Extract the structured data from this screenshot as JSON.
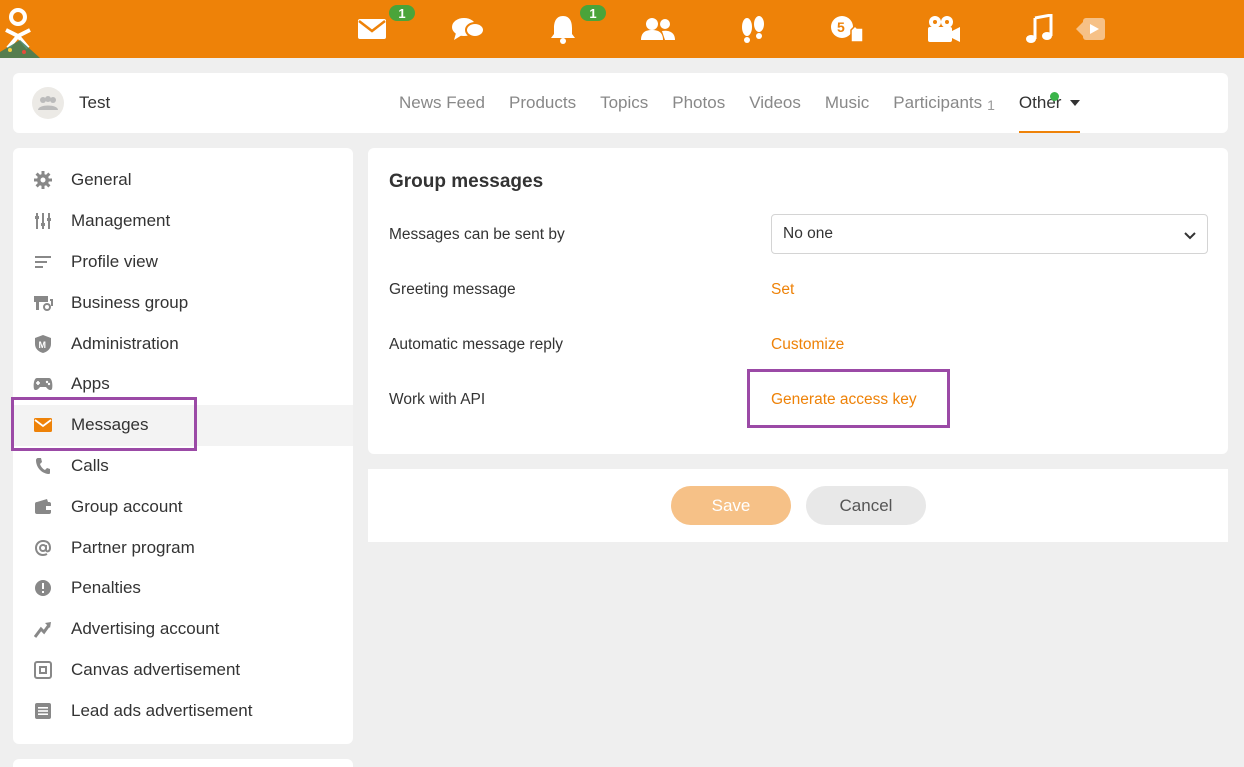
{
  "topbar": {
    "brand_color": "#ee8208",
    "icons": [
      {
        "name": "messages-icon",
        "badge": "1"
      },
      {
        "name": "discussions-icon",
        "badge": ""
      },
      {
        "name": "notifications-icon",
        "badge": "1"
      },
      {
        "name": "friends-icon",
        "badge": ""
      },
      {
        "name": "guests-icon",
        "badge": ""
      },
      {
        "name": "events-icon",
        "badge": ""
      },
      {
        "name": "video-icon",
        "badge": ""
      },
      {
        "name": "music-icon",
        "badge": ""
      }
    ]
  },
  "group": {
    "name": "Test",
    "tabs": [
      {
        "label": "News Feed"
      },
      {
        "label": "Products"
      },
      {
        "label": "Topics"
      },
      {
        "label": "Photos"
      },
      {
        "label": "Videos"
      },
      {
        "label": "Music"
      },
      {
        "label": "Participants",
        "count": "1"
      },
      {
        "label": "Other"
      }
    ]
  },
  "sidebar": {
    "items": [
      {
        "label": "General",
        "icon": "gear-icon"
      },
      {
        "label": "Management",
        "icon": "sliders-icon"
      },
      {
        "label": "Profile view",
        "icon": "lines-icon"
      },
      {
        "label": "Business group",
        "icon": "business-icon"
      },
      {
        "label": "Administration",
        "icon": "shield-icon"
      },
      {
        "label": "Apps",
        "icon": "gamepad-icon"
      },
      {
        "label": "Messages",
        "icon": "envelope-icon"
      },
      {
        "label": "Calls",
        "icon": "phone-icon"
      },
      {
        "label": "Group account",
        "icon": "wallet-icon"
      },
      {
        "label": "Partner program",
        "icon": "at-icon"
      },
      {
        "label": "Penalties",
        "icon": "alert-icon"
      },
      {
        "label": "Advertising account",
        "icon": "trend-icon"
      },
      {
        "label": "Canvas advertisement",
        "icon": "canvas-icon"
      },
      {
        "label": "Lead ads advertisement",
        "icon": "list-icon"
      }
    ]
  },
  "main": {
    "title": "Group messages",
    "rows": {
      "sent_by_label": "Messages can be sent by",
      "sent_by_value": "No one",
      "greeting_label": "Greeting message",
      "greeting_action": "Set",
      "auto_reply_label": "Automatic message reply",
      "auto_reply_action": "Customize",
      "api_label": "Work with API",
      "api_action": "Generate access key"
    },
    "save_label": "Save",
    "cancel_label": "Cancel"
  },
  "colors": {
    "accent": "#ee8208",
    "highlight": "#9b4aa6",
    "badge": "#4aa43a",
    "online_dot": "#3bb44a"
  }
}
